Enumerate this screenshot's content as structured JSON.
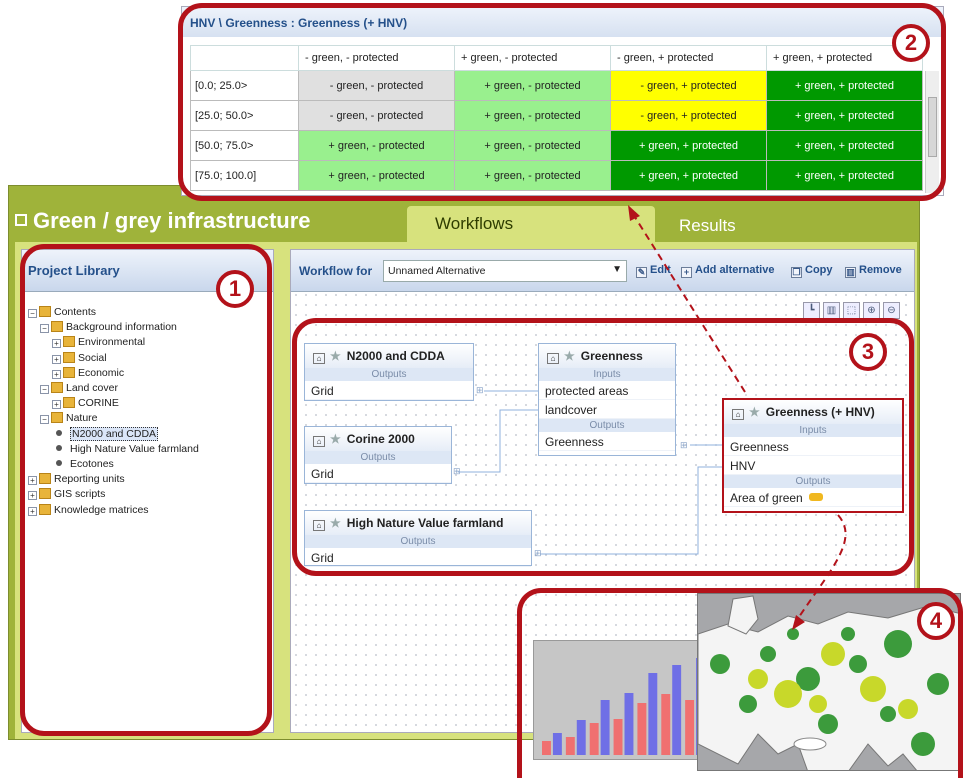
{
  "app": {
    "title": "Green / grey infrastructure",
    "tabs": [
      {
        "label": "Workflows",
        "active": true
      },
      {
        "label": "Results",
        "active": false
      }
    ]
  },
  "library": {
    "title": "Project Library",
    "tree": [
      {
        "label": "Contents",
        "depth": 0,
        "kind": "folder",
        "expanded": true
      },
      {
        "label": "Background information",
        "depth": 1,
        "kind": "folder",
        "expanded": true
      },
      {
        "label": "Environmental",
        "depth": 2,
        "kind": "folder",
        "expanded": false
      },
      {
        "label": "Social",
        "depth": 2,
        "kind": "folder",
        "expanded": false
      },
      {
        "label": "Economic",
        "depth": 2,
        "kind": "folder",
        "expanded": false
      },
      {
        "label": "Land cover",
        "depth": 1,
        "kind": "folder",
        "expanded": true
      },
      {
        "label": "CORINE",
        "depth": 2,
        "kind": "folder",
        "expanded": false
      },
      {
        "label": "Nature",
        "depth": 1,
        "kind": "folder",
        "expanded": true
      },
      {
        "label": "N2000 and CDDA",
        "depth": 2,
        "kind": "item",
        "selected": true
      },
      {
        "label": "High Nature Value farmland",
        "depth": 2,
        "kind": "item"
      },
      {
        "label": "Ecotones",
        "depth": 2,
        "kind": "item"
      },
      {
        "label": "Reporting units",
        "depth": 0,
        "kind": "folder",
        "expanded": false
      },
      {
        "label": "GIS scripts",
        "depth": 0,
        "kind": "folder",
        "expanded": false
      },
      {
        "label": "Knowledge matrices",
        "depth": 0,
        "kind": "folder",
        "expanded": false
      }
    ]
  },
  "workflow": {
    "for_label": "Workflow for",
    "alternative": "Unnamed Alternative",
    "toolbar": {
      "edit": "Edit",
      "add_alternative": "Add alternative",
      "copy": "Copy",
      "remove": "Remove"
    },
    "nodes": {
      "n2000": {
        "title": "N2000 and CDDA",
        "outputs_label": "Outputs",
        "outputs": [
          "Grid"
        ]
      },
      "corine": {
        "title": "Corine 2000",
        "outputs_label": "Outputs",
        "outputs": [
          "Grid"
        ]
      },
      "hnvf": {
        "title": "High Nature Value farmland",
        "outputs_label": "Outputs",
        "outputs": [
          "Grid"
        ]
      },
      "greenness": {
        "title": "Greenness",
        "inputs_label": "Inputs",
        "inputs": [
          "protected areas",
          "landcover"
        ],
        "outputs_label": "Outputs",
        "outputs": [
          "Greenness"
        ]
      },
      "greenness_hnv": {
        "title": "Greenness (+ HNV)",
        "inputs_label": "Inputs",
        "inputs": [
          "Greenness",
          "HNV"
        ],
        "outputs_label": "Outputs",
        "outputs": [
          "Area of green"
        ]
      }
    }
  },
  "matrix": {
    "title": "HNV \\ Greenness : Greenness (+ HNV)",
    "columns": [
      "- green, - protected",
      "+ green, - protected",
      "- green, + protected",
      "+ green, + protected"
    ],
    "rows": [
      {
        "label": "[0.0; 25.0>",
        "cells": [
          "- green, - protected",
          "+ green, - protected",
          "- green, + protected",
          "+ green, + protected"
        ]
      },
      {
        "label": "[25.0; 50.0>",
        "cells": [
          "- green, - protected",
          "+ green, - protected",
          "- green, + protected",
          "+ green, + protected"
        ]
      },
      {
        "label": "[50.0; 75.0>",
        "cells": [
          "+ green, - protected",
          "+ green, - protected",
          "+ green, + protected",
          "+ green, + protected"
        ]
      },
      {
        "label": "[75.0; 100.0]",
        "cells": [
          "+ green, - protected",
          "+ green, - protected",
          "+ green, + protected",
          "+ green, + protected"
        ]
      }
    ],
    "value_colors": {
      "- green, - protected": "#e0e0e0",
      "+ green, - protected": "#99f08e",
      "- green, + protected": "#ffff00",
      "+ green, + protected": "#009900"
    }
  },
  "annotations": {
    "badges": [
      "1",
      "2",
      "3",
      "4"
    ],
    "color": "#b3121a"
  },
  "chart_data": {
    "type": "bar",
    "series": [
      {
        "color": "#f07070",
        "values": [
          14,
          18,
          32,
          36,
          52,
          61,
          55
        ]
      },
      {
        "color": "#6f6fe6",
        "values": [
          22,
          35,
          55,
          62,
          82,
          90,
          97
        ]
      }
    ],
    "ylim": [
      0,
      100
    ],
    "grid": false
  }
}
